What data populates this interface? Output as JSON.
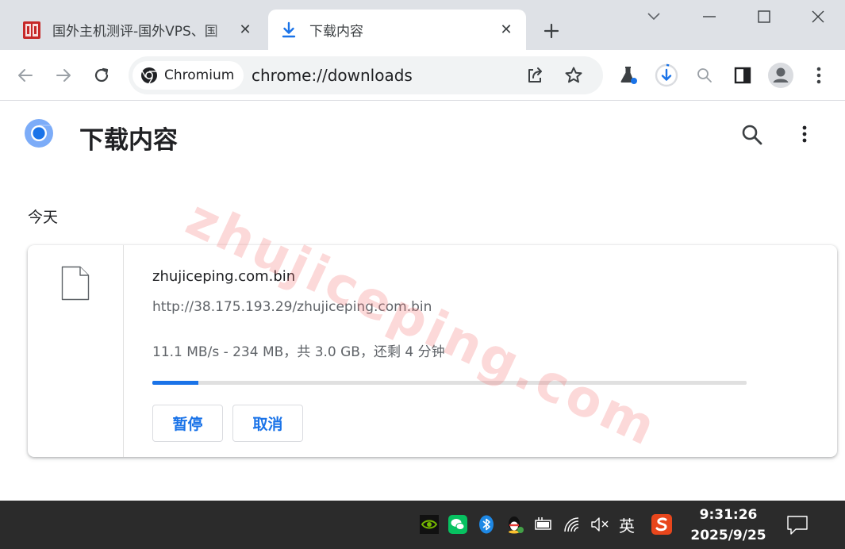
{
  "browser": {
    "tabs": [
      {
        "title": "国外主机测评-国外VPS、国",
        "active": false,
        "icon": "site-favicon"
      },
      {
        "title": "下载内容",
        "active": true,
        "icon": "download-icon"
      }
    ],
    "close_glyph": "✕",
    "omnibox": {
      "chip_label": "Chromium",
      "url": "chrome://downloads"
    }
  },
  "page": {
    "title": "下载内容",
    "section_label": "今天",
    "downloads": [
      {
        "file_name": "zhujiceping.com.bin",
        "url": "http://38.175.193.29/zhujiceping.com.bin",
        "status": "11.1 MB/s - 234 MB，共 3.0 GB，还剩 4 分钟",
        "progress_fraction": 0.078,
        "pause_label": "暂停",
        "cancel_label": "取消"
      }
    ]
  },
  "watermark": "zhujiceping.com",
  "taskbar": {
    "ime_label": "英",
    "time": "9:31:26",
    "date": "2025/9/25"
  },
  "colors": {
    "accent": "#1a73e8",
    "tabstrip": "#dee1e6",
    "taskbar": "#2b2b2b"
  }
}
